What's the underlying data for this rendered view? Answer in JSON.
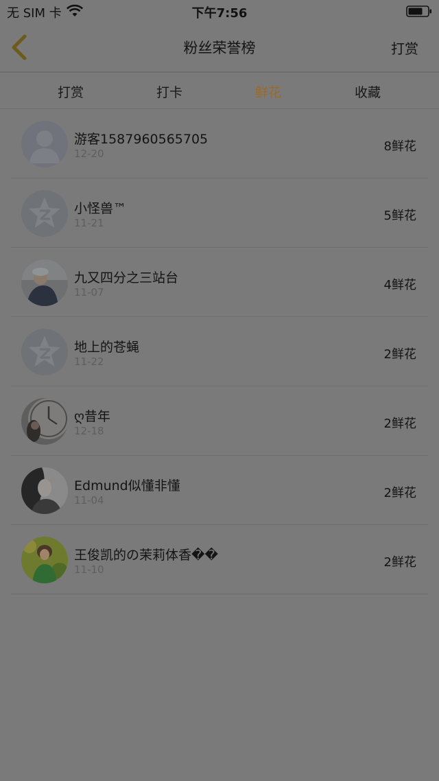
{
  "status_bar": {
    "carrier": "无 SIM 卡",
    "time": "下午7:56"
  },
  "nav": {
    "title": "粉丝荣誉榜",
    "right_action": "打赏"
  },
  "tabs": [
    {
      "label": "打赏"
    },
    {
      "label": "打卡"
    },
    {
      "label": "鲜花",
      "active": true
    },
    {
      "label": "收藏"
    }
  ],
  "colors": {
    "active_tab": "#9e6a22",
    "overlay_background": "#7a7a7a"
  },
  "ranking": [
    {
      "name": "游客1587960565705",
      "date": "12-20",
      "value": "8鲜花",
      "avatar": "default-user-avatar"
    },
    {
      "name": "小怪兽™",
      "date": "11-21",
      "value": "5鲜花",
      "avatar": "qq-star-avatar"
    },
    {
      "name": "九又四分之三站台",
      "date": "11-07",
      "value": "4鲜花",
      "avatar": "photo-avatar"
    },
    {
      "name": "地上的苍蝇",
      "date": "11-22",
      "value": "2鲜花",
      "avatar": "qq-star-avatar"
    },
    {
      "name": "ღ昔年",
      "date": "12-18",
      "value": "2鲜花",
      "avatar": "clock-photo-avatar"
    },
    {
      "name": "Edmund似懂非懂",
      "date": "11-04",
      "value": "2鲜花",
      "avatar": "photo-avatar"
    },
    {
      "name": "王俊凯的の茉莉体香��",
      "date": "11-10",
      "value": "2鲜花",
      "avatar": "photo-avatar"
    }
  ]
}
